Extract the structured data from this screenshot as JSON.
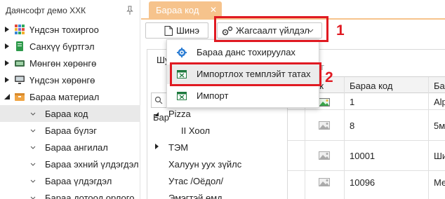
{
  "sidebar": {
    "title": "Даянсофт демо ХХК",
    "items": [
      {
        "label": "Үндсэн тохиргоо"
      },
      {
        "label": "Санхүү бүртгэл"
      },
      {
        "label": "Мөнгөн хөрөнгө"
      },
      {
        "label": "Үндсэн хөрөнгө"
      },
      {
        "label": "Бараа материал"
      },
      {
        "label": "Бараа код"
      },
      {
        "label": "Бараа бүлэг"
      },
      {
        "label": "Бараа ангилал"
      },
      {
        "label": "Бараа эхний үлдэгдэл"
      },
      {
        "label": "Бараа үлдэгдэл"
      },
      {
        "label": "Бараа дотоод орлого"
      }
    ]
  },
  "tabs": [
    {
      "label": "Бараа код",
      "close": "✕"
    }
  ],
  "toolbar": {
    "new_label": "Шинэ",
    "extra_label": "Жагсаалт үйлдэл"
  },
  "menu": {
    "items": [
      {
        "label": "Бараа данс тохируулах"
      },
      {
        "label": "Импортлох темплэйт татах"
      },
      {
        "label": "Импорт"
      }
    ]
  },
  "tree": {
    "title": "Шу",
    "header": "Бар",
    "rows": [
      {
        "label": "Pizza"
      },
      {
        "label": "II Хоол"
      },
      {
        "label": "ТЭМ"
      },
      {
        "label": "Халуун ууx зүйлс"
      },
      {
        "label": "Утас /Оёдол/"
      },
      {
        "label": "Эмэгтэй өмд"
      }
    ]
  },
  "grid": {
    "columns": [
      "ак",
      "Бараа код",
      "Бар"
    ],
    "rows": [
      {
        "code": "1",
        "name": "Alp"
      },
      {
        "code": "8",
        "name": "5ми"
      },
      {
        "code": "10001",
        "name": "Ши"
      },
      {
        "code": "10096",
        "name": "Ме"
      }
    ],
    "faded_col": "т"
  },
  "annotations": {
    "label_1": "1",
    "label_2": "2",
    "color": "#e01a22"
  },
  "colors": {
    "tab_bg": "#f6c38c",
    "menu_hover": "#ebebeb"
  }
}
